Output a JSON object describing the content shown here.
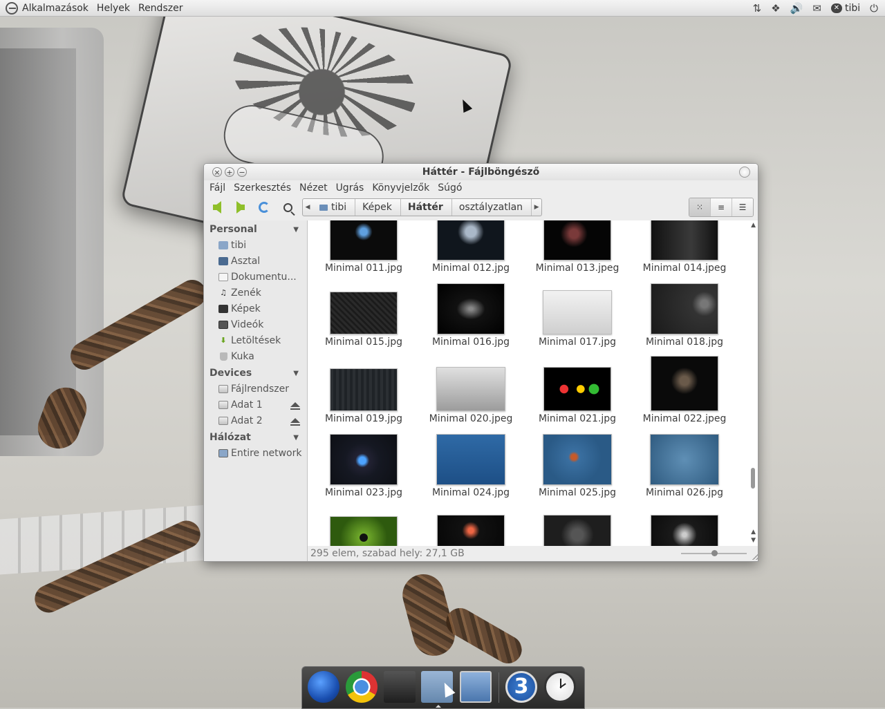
{
  "top_panel": {
    "menus": [
      "Alkalmazások",
      "Helyek",
      "Rendszer"
    ],
    "user": "tibi"
  },
  "window": {
    "title": "Háttér - Fájlböngésző",
    "menu": [
      "Fájl",
      "Szerkesztés",
      "Nézet",
      "Ugrás",
      "Könyvjelzők",
      "Súgó"
    ],
    "path": [
      "tibi",
      "Képek",
      "Háttér",
      "osztályzatlan"
    ],
    "active_crumb": "Háttér"
  },
  "sidebar": {
    "sections": [
      {
        "title": "Personal",
        "items": [
          {
            "label": "tibi",
            "icon": "home-folder-icon"
          },
          {
            "label": "Asztal",
            "icon": "desktop-icon"
          },
          {
            "label": "Dokumentu...",
            "icon": "document-icon"
          },
          {
            "label": "Zenék",
            "icon": "music-icon"
          },
          {
            "label": "Képek",
            "icon": "pictures-icon"
          },
          {
            "label": "Videók",
            "icon": "video-icon"
          },
          {
            "label": "Letöltések",
            "icon": "download-icon"
          },
          {
            "label": "Kuka",
            "icon": "trash-icon"
          }
        ]
      },
      {
        "title": "Devices",
        "items": [
          {
            "label": "Fájlrendszer",
            "icon": "drive-icon"
          },
          {
            "label": "Adat 1",
            "icon": "drive-icon",
            "eject": true
          },
          {
            "label": "Adat 2",
            "icon": "drive-icon",
            "eject": true
          }
        ]
      },
      {
        "title": "Hálózat",
        "items": [
          {
            "label": "Entire network",
            "icon": "network-icon"
          }
        ]
      }
    ]
  },
  "files": [
    {
      "name": "Minimal 011.jpg"
    },
    {
      "name": "Minimal 012.jpg"
    },
    {
      "name": "Minimal 013.jpeg"
    },
    {
      "name": "Minimal 014.jpeg"
    },
    {
      "name": "Minimal 015.jpg"
    },
    {
      "name": "Minimal 016.jpg"
    },
    {
      "name": "Minimal 017.jpg"
    },
    {
      "name": "Minimal 018.jpg"
    },
    {
      "name": "Minimal 019.jpg"
    },
    {
      "name": "Minimal 020.jpeg"
    },
    {
      "name": "Minimal 021.jpg"
    },
    {
      "name": "Minimal 022.jpeg"
    },
    {
      "name": "Minimal 023.jpg"
    },
    {
      "name": "Minimal 024.jpg"
    },
    {
      "name": "Minimal 025.jpg"
    },
    {
      "name": "Minimal 026.jpg"
    },
    {
      "name": ""
    },
    {
      "name": ""
    },
    {
      "name": ""
    },
    {
      "name": ""
    }
  ],
  "status": "295 elem, szabad hely: 27,1 GB",
  "dock": {
    "counter": "3"
  }
}
